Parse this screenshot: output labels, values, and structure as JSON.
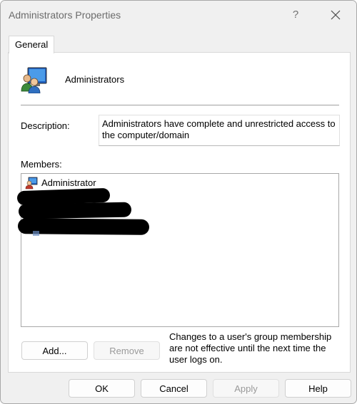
{
  "window": {
    "title": "Administrators Properties",
    "help_glyph": "?"
  },
  "tabs": [
    {
      "label": "General"
    }
  ],
  "group": {
    "name": "Administrators",
    "icon": "user-group-icon"
  },
  "description": {
    "label": "Description:",
    "value": "Administrators have complete and unrestricted access to the computer/domain"
  },
  "members": {
    "label": "Members:",
    "items": [
      {
        "name": "Administrator",
        "icon": "user-icon"
      }
    ]
  },
  "buttons": {
    "add": "Add...",
    "remove": "Remove",
    "ok": "OK",
    "cancel": "Cancel",
    "apply": "Apply",
    "help": "Help"
  },
  "membership_note": "Changes to a user's group membership are not effective until the next time the user logs on.",
  "colors": {
    "window_bg": "#f0f0f0",
    "panel_bg": "#ffffff",
    "disabled_text": "#9a9a9a"
  }
}
